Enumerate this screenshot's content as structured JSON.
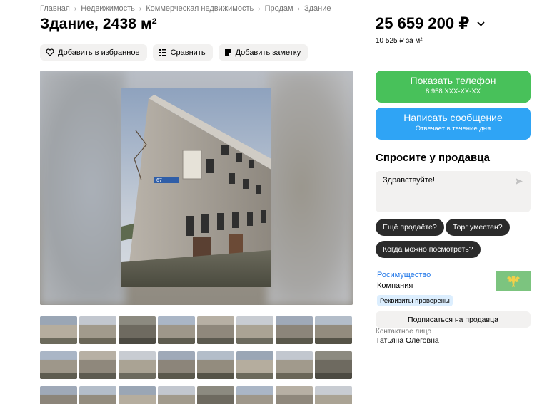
{
  "breadcrumb": [
    "Главная",
    "Недвижимость",
    "Коммерческая недвижимость",
    "Продам",
    "Здание"
  ],
  "listing": {
    "title": "Здание, 2438 м²",
    "price": "25 659 200 ₽",
    "price_per_meter": "10 525 ₽ за м²"
  },
  "actions": {
    "favorite": "Добавить в избранное",
    "compare": "Сравнить",
    "note": "Добавить заметку"
  },
  "contact_buttons": {
    "phone_label": "Показать телефон",
    "phone_number": "8 958 XXX-XX-XX",
    "message_label": "Написать сообщение",
    "message_sub": "Отвечает в течение дня"
  },
  "ask_seller": {
    "title": "Спросите у продавца",
    "message": "Здравствуйте!",
    "chips": [
      "Ещё продаёте?",
      "Торг уместен?",
      "Когда можно посмотреть?"
    ]
  },
  "seller": {
    "name": "Росимущество",
    "type": "Компания",
    "badge": "Реквизиты проверены",
    "subscribe": "Подписаться на продавца",
    "contact_label": "Контактное лицо",
    "contact_name": "Татьяна Олеговна"
  },
  "photo_sign": "67",
  "colors": {
    "green": "#48c15a",
    "blue": "#2fa4f5",
    "chip_dark": "#2b2b2b",
    "link": "#1a73e8",
    "badge_bg": "#dceefe"
  },
  "thumbnail_counts": [
    8,
    8,
    8
  ]
}
